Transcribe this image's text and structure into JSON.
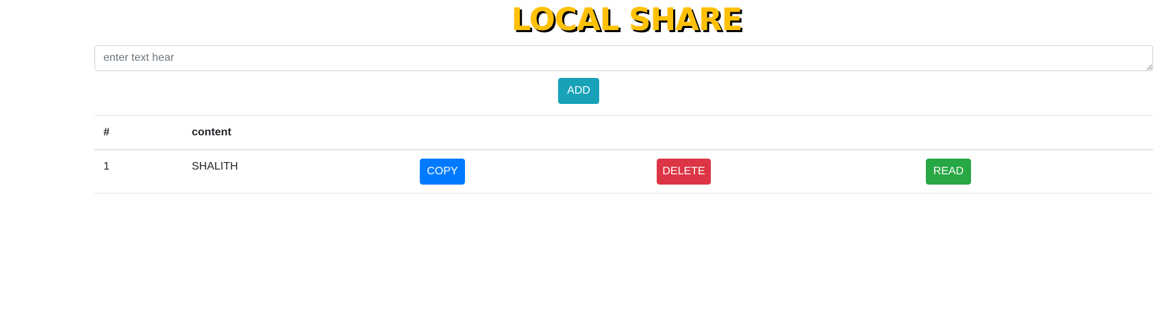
{
  "header": {
    "title": "LOCAL SHARE"
  },
  "input": {
    "placeholder": "enter text hear",
    "value": ""
  },
  "add_button": {
    "label": "ADD"
  },
  "table": {
    "columns": [
      "#",
      "content"
    ],
    "rows": [
      {
        "num": "1",
        "content": "SHALITH",
        "copy_label": "COPY",
        "delete_label": "DELETE",
        "read_label": "READ"
      }
    ]
  },
  "colors": {
    "title": "#ffc107",
    "add": "#17a2b8",
    "copy": "#007bff",
    "delete": "#dc3545",
    "read": "#28a745"
  }
}
